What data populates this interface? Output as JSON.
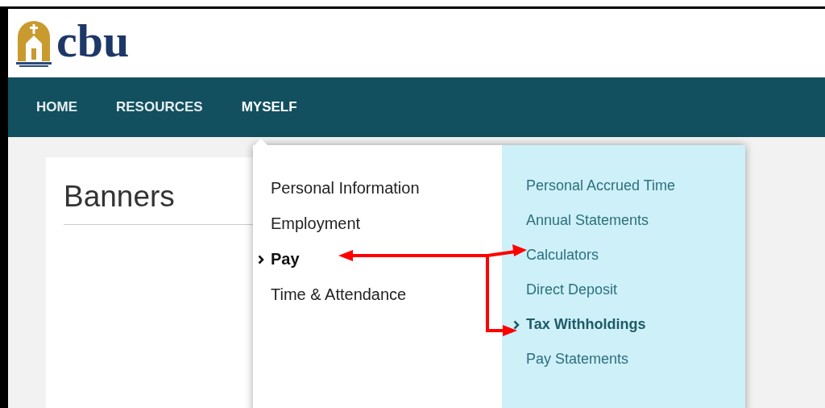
{
  "logo": {
    "text": "cbu"
  },
  "nav": [
    {
      "label": "HOME",
      "selected": false
    },
    {
      "label": "RESOURCES",
      "selected": false
    },
    {
      "label": "MYSELF",
      "selected": true
    }
  ],
  "page": {
    "title": "Banners"
  },
  "menu": {
    "items": [
      {
        "label": "Personal Information",
        "selected": false
      },
      {
        "label": "Employment",
        "selected": false
      },
      {
        "label": "Pay",
        "selected": true
      },
      {
        "label": "Time & Attendance",
        "selected": false
      }
    ],
    "submenu": [
      {
        "label": "Personal Accrued Time",
        "selected": false
      },
      {
        "label": "Annual Statements",
        "selected": false
      },
      {
        "label": "Calculators",
        "selected": false
      },
      {
        "label": "Direct Deposit",
        "selected": false
      },
      {
        "label": "Tax Withholdings",
        "selected": true
      },
      {
        "label": "Pay Statements",
        "selected": false
      }
    ]
  }
}
